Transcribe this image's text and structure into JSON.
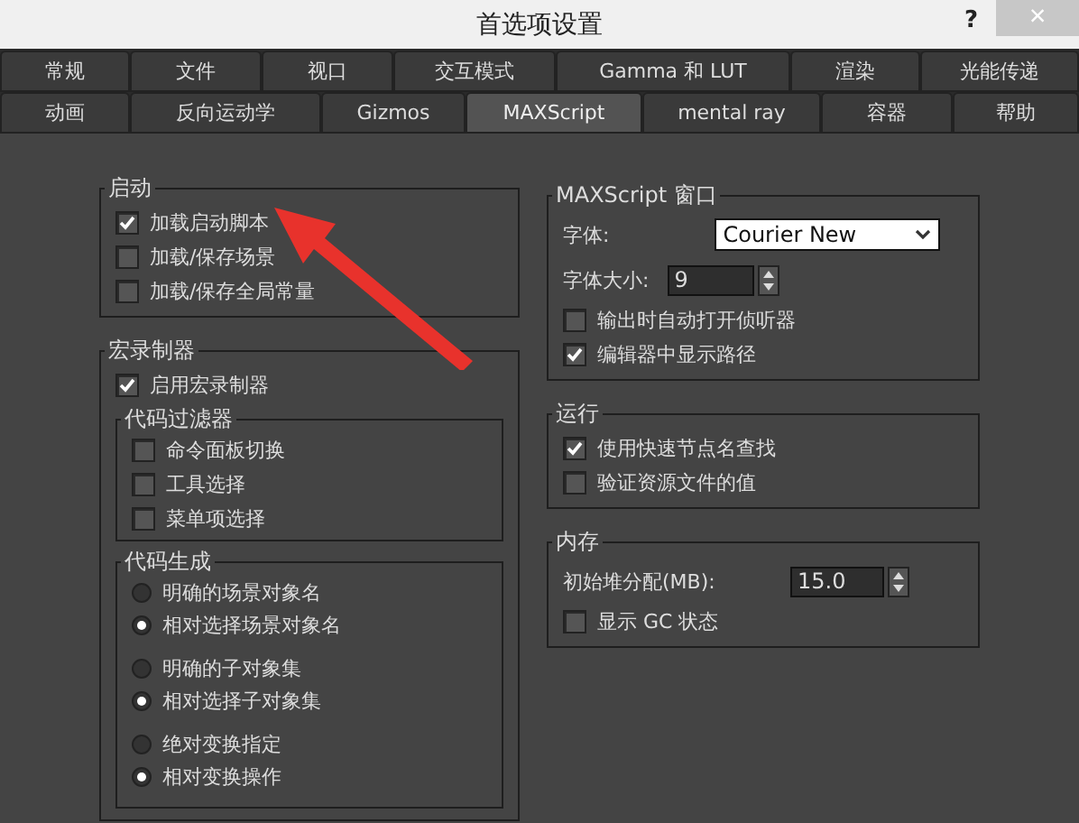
{
  "window": {
    "title": "首选项设置",
    "help": "?",
    "close": "×"
  },
  "tab_rows": [
    [
      {
        "label": "常规",
        "selected": false
      },
      {
        "label": "文件",
        "selected": false
      },
      {
        "label": "视口",
        "selected": false
      },
      {
        "label": "交互模式",
        "selected": false
      },
      {
        "label": "Gamma 和 LUT",
        "selected": false
      },
      {
        "label": "渲染",
        "selected": false
      },
      {
        "label": "光能传递",
        "selected": false
      }
    ],
    [
      {
        "label": "动画",
        "selected": false
      },
      {
        "label": "反向运动学",
        "selected": false
      },
      {
        "label": "Gizmos",
        "selected": false
      },
      {
        "label": "MAXScript",
        "selected": true
      },
      {
        "label": "mental ray",
        "selected": false
      },
      {
        "label": "容器",
        "selected": false
      },
      {
        "label": "帮助",
        "selected": false
      }
    ]
  ],
  "left_groups": [
    {
      "title": "启动",
      "items": [
        {
          "kind": "checkbox",
          "label": "加载启动脚本",
          "checked": true
        },
        {
          "kind": "checkbox",
          "label": "加载/保存场景",
          "checked": false
        },
        {
          "kind": "checkbox",
          "label": "加载/保存全局常量",
          "checked": false
        }
      ]
    },
    {
      "title": "宏录制器",
      "items": [
        {
          "kind": "checkbox",
          "label": "启用宏录制器",
          "checked": true
        },
        {
          "kind": "group",
          "title": "代码过滤器",
          "items": [
            {
              "kind": "checkbox",
              "label": "命令面板切换",
              "checked": false
            },
            {
              "kind": "checkbox",
              "label": "工具选择",
              "checked": false
            },
            {
              "kind": "checkbox",
              "label": "菜单项选择",
              "checked": false
            }
          ]
        },
        {
          "kind": "group",
          "title": "代码生成",
          "items": [
            {
              "kind": "radios",
              "options": [
                {
                  "label": "明确的场景对象名",
                  "selected": false
                },
                {
                  "label": "相对选择场景对象名",
                  "selected": true
                }
              ]
            },
            {
              "kind": "radios",
              "options": [
                {
                  "label": "明确的子对象集",
                  "selected": false
                },
                {
                  "label": "相对选择子对象集",
                  "selected": true
                }
              ]
            },
            {
              "kind": "radios",
              "options": [
                {
                  "label": "绝对变换指定",
                  "selected": false
                },
                {
                  "label": "相对变换操作",
                  "selected": true
                }
              ]
            }
          ]
        }
      ]
    }
  ],
  "right_groups": [
    {
      "title": "MAXScript 窗口",
      "items": [
        {
          "kind": "select",
          "label": "字体:",
          "value": "Courier New"
        },
        {
          "kind": "spinner",
          "label": "字体大小:",
          "value": "9"
        },
        {
          "kind": "checkbox",
          "label": "输出时自动打开侦听器",
          "checked": false
        },
        {
          "kind": "checkbox",
          "label": "编辑器中显示路径",
          "checked": true
        }
      ]
    },
    {
      "title": "运行",
      "items": [
        {
          "kind": "checkbox",
          "label": "使用快速节点名查找",
          "checked": true
        },
        {
          "kind": "checkbox",
          "label": "验证资源文件的值",
          "checked": false
        }
      ]
    },
    {
      "title": "内存",
      "items": [
        {
          "kind": "right_spinner",
          "label": "初始堆分配(MB):",
          "value": "15.0"
        },
        {
          "kind": "checkbox",
          "label": "显示 GC 状态",
          "checked": false
        }
      ]
    }
  ]
}
